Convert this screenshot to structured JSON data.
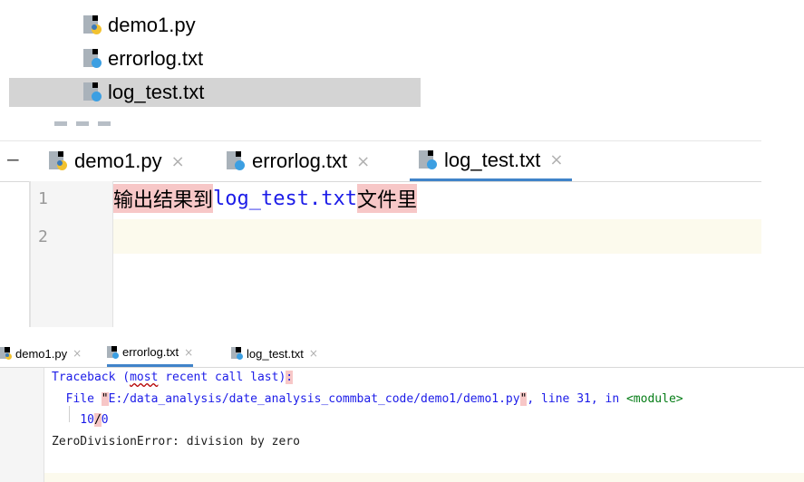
{
  "project_tree": {
    "items": [
      {
        "label": "demo1.py",
        "icon": "python-file-icon"
      },
      {
        "label": "errorlog.txt",
        "icon": "text-file-icon"
      },
      {
        "label": "log_test.txt",
        "icon": "text-file-icon",
        "selected": true
      }
    ]
  },
  "editor": {
    "tabs": [
      {
        "label": "demo1.py",
        "close": "×",
        "icon": "python-file-icon"
      },
      {
        "label": "errorlog.txt",
        "close": "×",
        "icon": "text-file-icon"
      },
      {
        "label": "log_test.txt",
        "close": "×",
        "icon": "text-file-icon",
        "active": true
      }
    ],
    "collapse_glyph": "−",
    "line_numbers": [
      "1",
      "2"
    ],
    "line1": {
      "part1": "输出结果到",
      "part2": "log_test.txt",
      "part3": "文件里"
    }
  },
  "console": {
    "tabs": [
      {
        "label": "demo1.py",
        "close": "×",
        "icon": "python-file-icon"
      },
      {
        "label": "errorlog.txt",
        "close": "×",
        "icon": "text-file-icon",
        "active": true
      },
      {
        "label": "log_test.txt",
        "close": "×",
        "icon": "text-file-icon"
      }
    ],
    "traceback": {
      "l1_a": "Traceback (",
      "l1_most": "most",
      "l1_b": " recent call last)",
      "l1_colon": ":",
      "l2_a": "  File ",
      "l2_q1": "\"",
      "l2_path": "E:/data_analysis/date_analysis_commbat_code/demo1/demo1.py",
      "l2_q2": "\"",
      "l2_b": ", line 31, in ",
      "l2_module": "<module>",
      "l3_a": "    10",
      "l3_slash": "/",
      "l3_b": "0",
      "l4": "ZeroDivisionError: division by zero"
    }
  },
  "colors": {
    "active_tab_underline": "#4083c9",
    "highlight_red": "#f7c7c7",
    "string_blue": "#1c1ce8",
    "current_line": "#fcfaed"
  }
}
